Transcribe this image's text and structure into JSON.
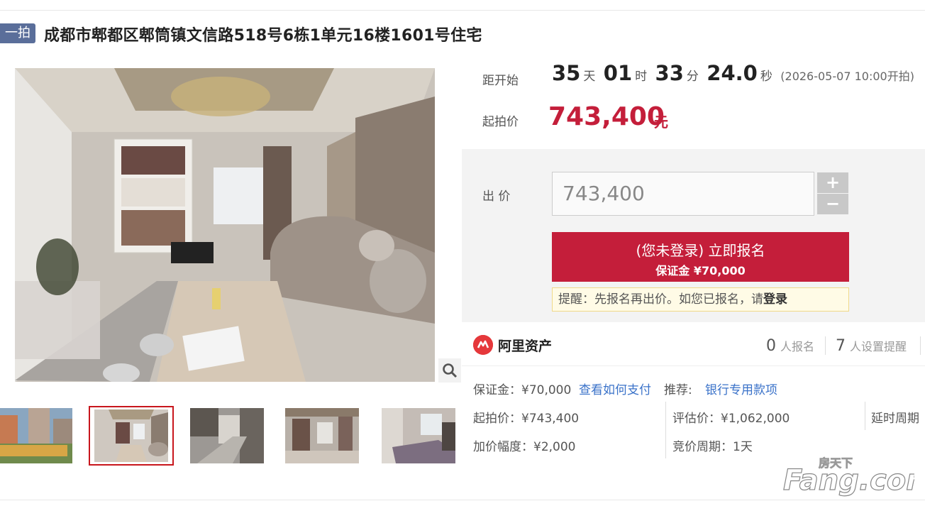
{
  "header": {
    "badge": "一拍",
    "title": "成都市郫都区郫筒镇文信路518号6栋1单元16楼1601号住宅"
  },
  "countdown": {
    "label": "距开始",
    "days": "35",
    "days_unit": "天",
    "hours": "01",
    "hours_unit": "时",
    "minutes": "33",
    "minutes_unit": "分",
    "seconds": "24.0",
    "seconds_unit": "秒",
    "start_time": "(2026-05-07 10:00开拍)"
  },
  "start_price": {
    "label": "起拍价",
    "value": "743,400",
    "unit": "元"
  },
  "bid": {
    "label": "出 价",
    "input_value": "743,400",
    "plus": "+",
    "minus": "−",
    "register_line1": "(您未登录) 立即报名",
    "register_line2": "保证金 ¥70,000",
    "tip_prefix": "提醒：先报名再出价。如您已报名，请",
    "tip_login": "登录"
  },
  "ali": {
    "name": "阿里资产",
    "signup_count": "0",
    "signup_label": "人报名",
    "remind_count": "7",
    "remind_label": "人设置提醒"
  },
  "info": {
    "deposit": "保证金：¥70,000",
    "how_to_pay": "查看如何支付",
    "recommend_label": "推荐:",
    "recommend_link": "银行专用款项",
    "start_price": "起拍价：¥743,400",
    "appraisal": "评估价：¥1,062,000",
    "delay_period": "延时周期",
    "increment": "加价幅度：¥2,000",
    "bid_period": "竞价周期：1天"
  },
  "watermark": {
    "top": "房天下",
    "brand": "Fang.com"
  },
  "icons": {
    "zoom": "magnifier-icon",
    "ali_logo": "ali-asset-logo-icon"
  },
  "colors": {
    "accent_red": "#c41e3a",
    "badge_blue": "#5a6e9a",
    "link_blue": "#3a72c9"
  }
}
